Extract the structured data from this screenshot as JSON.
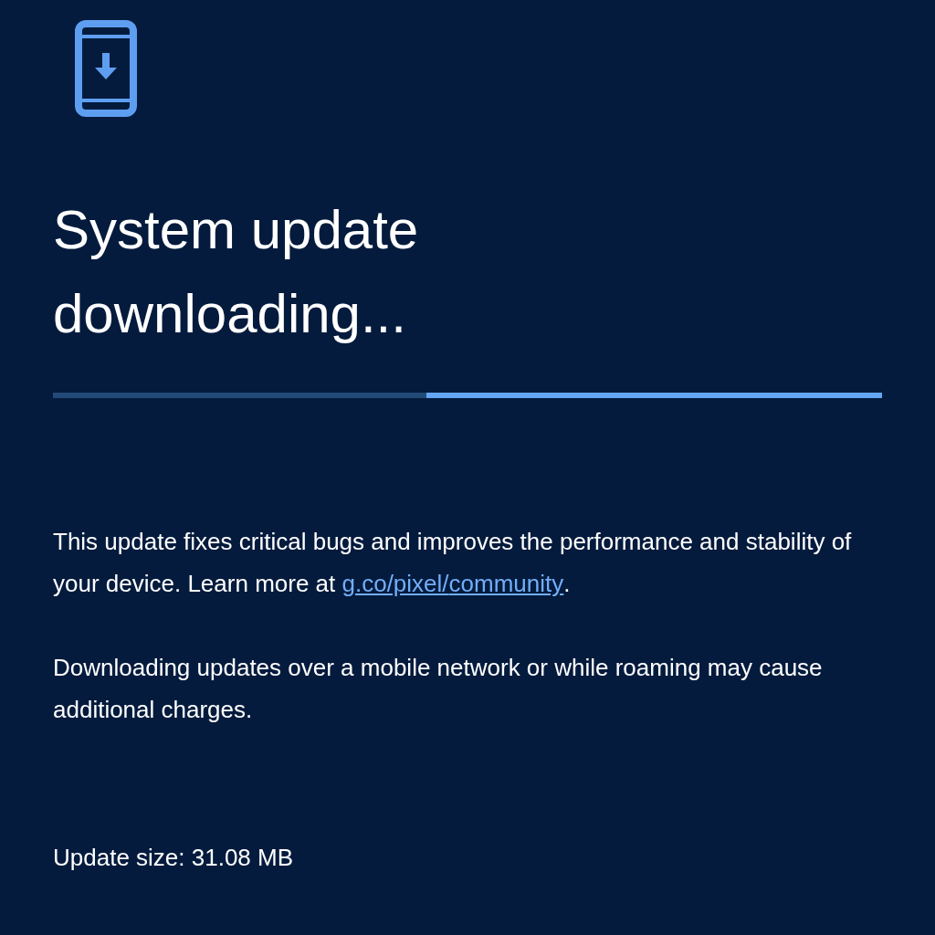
{
  "title": "System update downloading...",
  "progress": {
    "level": 0.55
  },
  "description": [
    {
      "kind": "text",
      "text": "This update fixes critical bugs and improves the performance and stability of your device. Learn more at "
    },
    {
      "kind": "link",
      "text": "g.co/pixel/"
    },
    {
      "kind": "link",
      "text": "community"
    },
    {
      "kind": "text",
      "text": "."
    }
  ],
  "notice": "Downloading updates over a mobile network or while roaming may cause additional charges.",
  "update_size": "Update size: 31.08 MB"
}
